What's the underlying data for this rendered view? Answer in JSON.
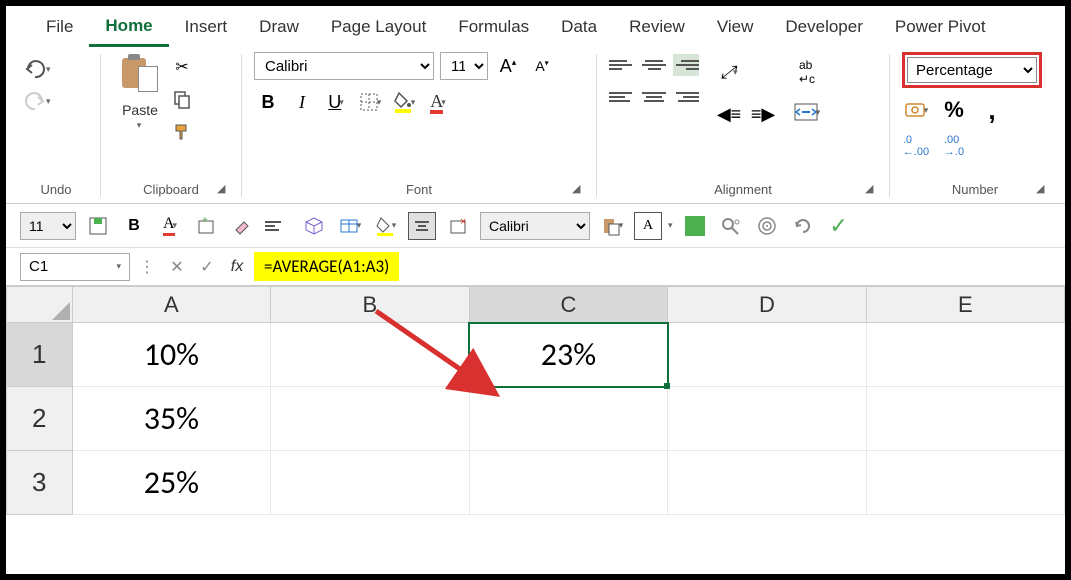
{
  "menu": {
    "items": [
      "File",
      "Home",
      "Insert",
      "Draw",
      "Page Layout",
      "Formulas",
      "Data",
      "Review",
      "View",
      "Developer",
      "Power Pivot"
    ],
    "active": "Home"
  },
  "ribbon": {
    "undo_label": "Undo",
    "clipboard": {
      "label": "Clipboard",
      "paste": "Paste"
    },
    "font": {
      "label": "Font",
      "name": "Calibri",
      "size": "11"
    },
    "alignment": {
      "label": "Alignment"
    },
    "number": {
      "label": "Number",
      "format": "Percentage"
    }
  },
  "qat": {
    "size": "11",
    "font": "Calibri"
  },
  "fbar": {
    "name": "C1",
    "formula": "=AVERAGE(A1:A3)"
  },
  "grid": {
    "cols": [
      "A",
      "B",
      "C",
      "D",
      "E"
    ],
    "rows": [
      "1",
      "2",
      "3"
    ],
    "cells": {
      "A1": "10%",
      "A2": "35%",
      "A3": "25%",
      "C1": "23%"
    },
    "active": "C1"
  }
}
